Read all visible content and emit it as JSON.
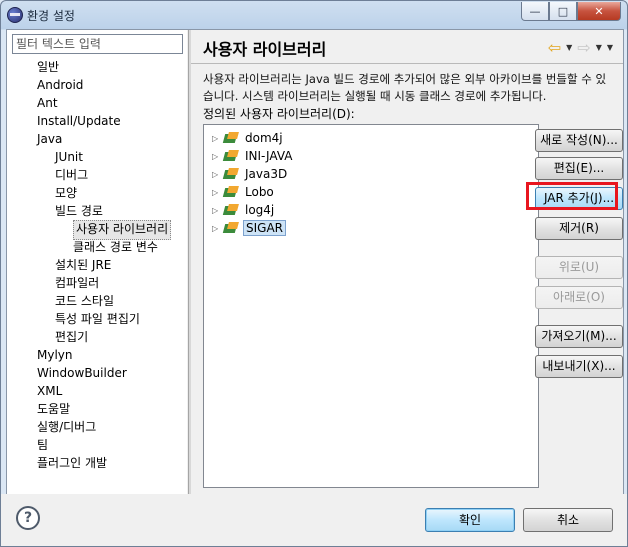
{
  "window": {
    "title": "환경 설정",
    "buttons": {
      "minimize": "—",
      "maximize": "□",
      "close": "✕"
    }
  },
  "filter": {
    "placeholder": "필터 텍스트 입력"
  },
  "tree": [
    {
      "label": "일반",
      "level": 0
    },
    {
      "label": "Android",
      "level": 0
    },
    {
      "label": "Ant",
      "level": 0
    },
    {
      "label": "Install/Update",
      "level": 0
    },
    {
      "label": "Java",
      "level": 0
    },
    {
      "label": "JUnit",
      "level": 1
    },
    {
      "label": "디버그",
      "level": 1
    },
    {
      "label": "모양",
      "level": 1
    },
    {
      "label": "빌드 경로",
      "level": 1
    },
    {
      "label": "사용자 라이브러리",
      "level": 2,
      "selected": true
    },
    {
      "label": "클래스 경로 변수",
      "level": 2
    },
    {
      "label": "설치된 JRE",
      "level": 1
    },
    {
      "label": "컴파일러",
      "level": 1
    },
    {
      "label": "코드 스타일",
      "level": 1
    },
    {
      "label": "특성 파일 편집기",
      "level": 1
    },
    {
      "label": "편집기",
      "level": 1
    },
    {
      "label": "Mylyn",
      "level": 0
    },
    {
      "label": "WindowBuilder",
      "level": 0
    },
    {
      "label": "XML",
      "level": 0
    },
    {
      "label": "도움말",
      "level": 0
    },
    {
      "label": "실행/디버그",
      "level": 0
    },
    {
      "label": "팀",
      "level": 0
    },
    {
      "label": "플러그인 개발",
      "level": 0
    }
  ],
  "page": {
    "title": "사용자 라이브러리",
    "description": "사용자 라이브러리는 Java 빌드 경로에 추가되어 많은 외부 아카이브를 번들할 수 있습니다. 시스템 라이브러리는 실행될 때 시동 클래스 경로에 추가됩니다.",
    "list_label": "정의된 사용자 라이브러리(D):",
    "libraries": [
      {
        "name": "dom4j"
      },
      {
        "name": "INI-JAVA"
      },
      {
        "name": "Java3D"
      },
      {
        "name": "Lobo"
      },
      {
        "name": "log4j"
      },
      {
        "name": "SIGAR",
        "selected": true
      }
    ],
    "buttons": {
      "new": "새로 작성(N)...",
      "edit": "편집(E)...",
      "add_jar": "JAR 추가(J)...",
      "remove": "제거(R)",
      "up": "위로(U)",
      "down": "아래로(O)",
      "import": "가져오기(M)...",
      "export": "내보내기(X)..."
    }
  },
  "footer": {
    "help": "?",
    "ok": "확인",
    "cancel": "취소"
  },
  "colors": {
    "highlight": "#e8161f",
    "selection": "#cde3f6"
  }
}
